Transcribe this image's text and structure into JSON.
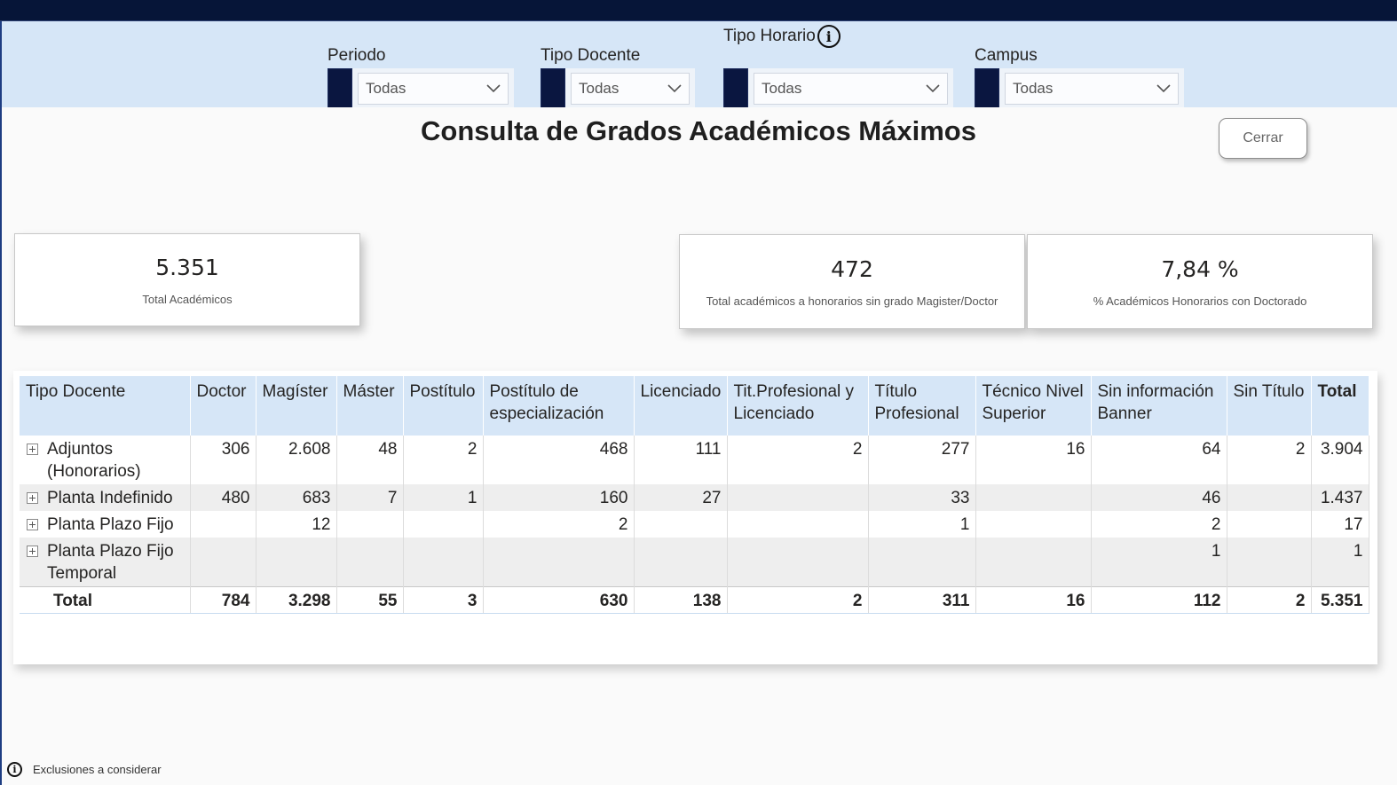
{
  "filters": [
    {
      "label": "Periodo",
      "value": "Todas",
      "has_info": false
    },
    {
      "label": "Tipo Docente",
      "value": "Todas",
      "has_info": false
    },
    {
      "label": "Tipo Horario",
      "value": "Todas",
      "has_info": true
    },
    {
      "label": "Campus",
      "value": "Todas",
      "has_info": false
    }
  ],
  "title": "Consulta de Grados Académicos Máximos",
  "close_button": "Cerrar",
  "cards": [
    {
      "value": "5.351",
      "label": "Total Académicos"
    },
    {
      "value": "472",
      "label": "Total académicos a honorarios sin grado Magister/Doctor"
    },
    {
      "value": "7,84 %",
      "label": "% Académicos Honorarios con Doctorado"
    }
  ],
  "table": {
    "headers": [
      "Tipo Docente",
      "Doctor",
      "Magíster",
      "Máster",
      "Postítulo",
      "Postítulo de especialización",
      "Licenciado",
      "Tit.Profesional y Licenciado",
      "Título Profesional",
      "Técnico Nivel Superior",
      "Sin información Banner",
      "Sin Título",
      "Total"
    ],
    "rows": [
      {
        "name": "Adjuntos (Honorarios)",
        "cells": [
          "306",
          "2.608",
          "48",
          "2",
          "468",
          "111",
          "2",
          "277",
          "16",
          "64",
          "2",
          "3.904"
        ]
      },
      {
        "name": "Planta Indefinido",
        "cells": [
          "480",
          "683",
          "7",
          "1",
          "160",
          "27",
          "",
          "33",
          "",
          "46",
          "",
          "1.437"
        ]
      },
      {
        "name": "Planta Plazo Fijo",
        "cells": [
          "",
          "12",
          "",
          "",
          "2",
          "",
          "",
          "1",
          "",
          "2",
          "",
          "17"
        ]
      },
      {
        "name": "Planta Plazo Fijo Temporal",
        "cells": [
          "",
          "",
          "",
          "",
          "",
          "",
          "",
          "",
          "",
          "1",
          "",
          "1"
        ]
      }
    ],
    "total": {
      "name": "Total",
      "cells": [
        "784",
        "3.298",
        "55",
        "3",
        "630",
        "138",
        "2",
        "311",
        "16",
        "112",
        "2",
        "5.351"
      ]
    }
  },
  "footer": {
    "label": "Exclusiones a considerar"
  },
  "icons": {
    "info": "info-icon",
    "dropdown": "chevron-down-icon",
    "expand": "expand-plus-icon"
  },
  "colors": {
    "top_bar": "#061538",
    "filter_band": "#d6e6f7",
    "header_bg": "#d6e6f7",
    "swatch": "#0a1640"
  }
}
